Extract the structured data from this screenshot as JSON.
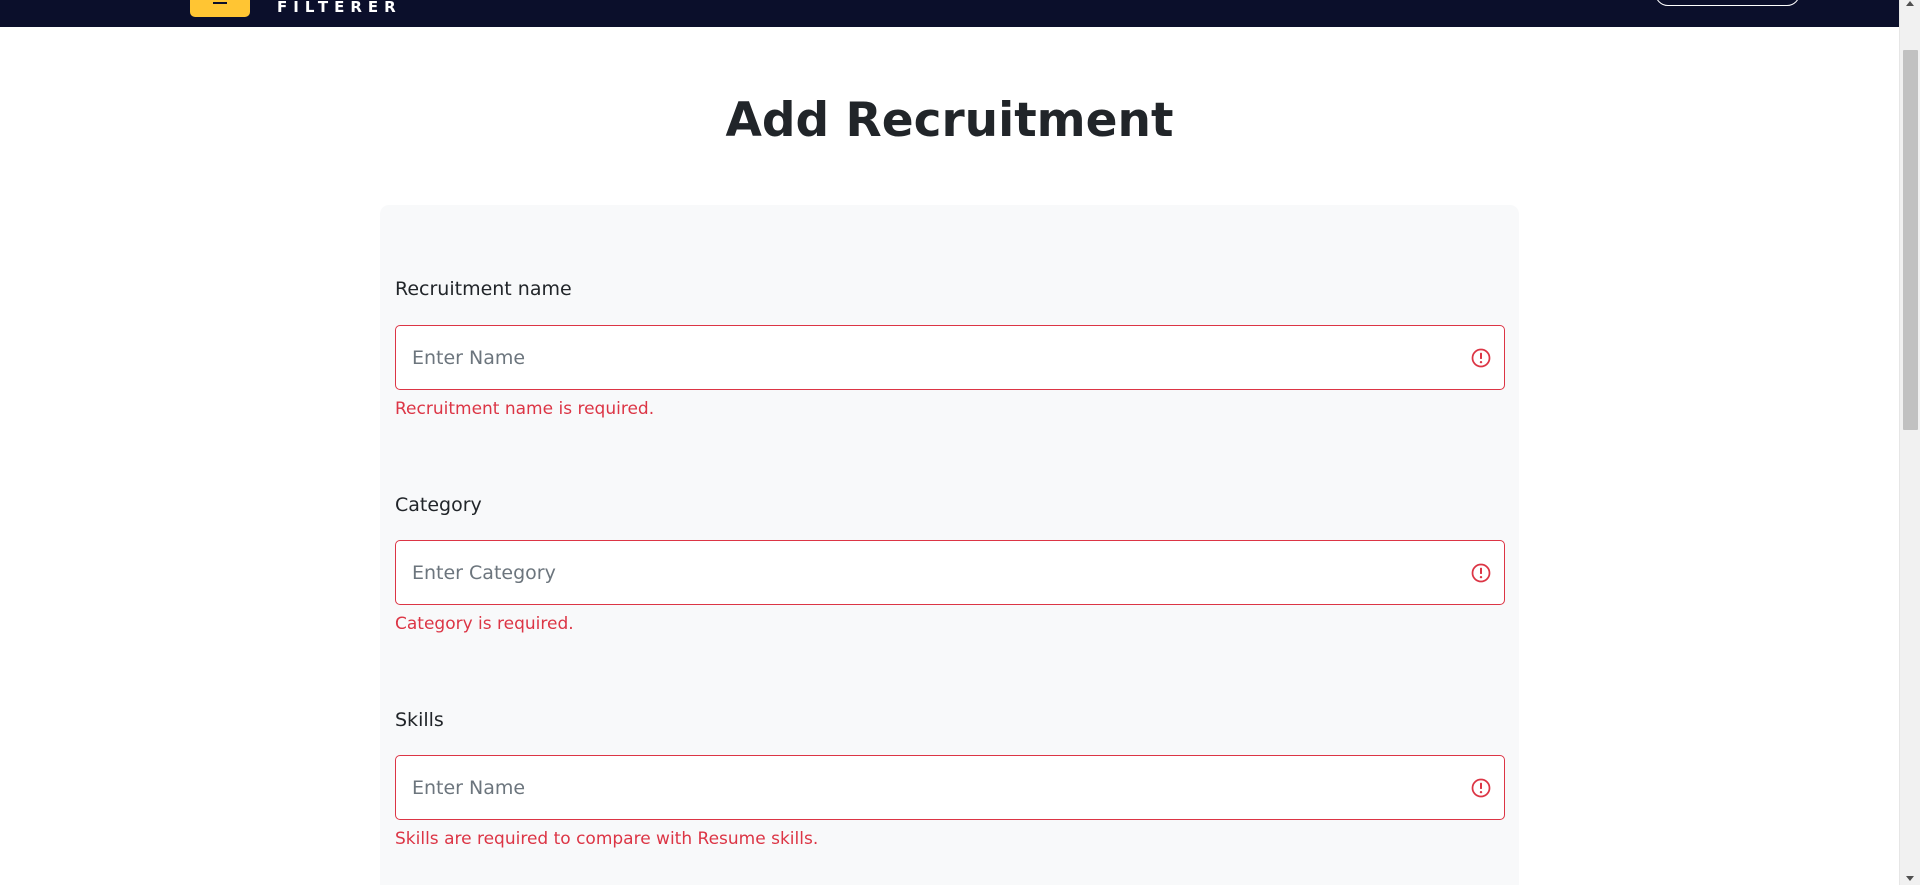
{
  "header": {
    "logo_text": "FILTERER"
  },
  "page": {
    "title": "Add Recruitment"
  },
  "form": {
    "fields": [
      {
        "label": "Recruitment name",
        "placeholder": "Enter Name",
        "value": "",
        "error": "Recruitment name is required.",
        "icon": "exclamation-circle-icon"
      },
      {
        "label": "Category",
        "placeholder": "Enter Category",
        "value": "",
        "error": "Category is required.",
        "icon": "exclamation-circle-icon"
      },
      {
        "label": "Skills",
        "placeholder": "Enter Name",
        "value": "",
        "error": "Skills are required to compare with Resume skills.",
        "icon": "exclamation-circle-icon"
      }
    ]
  },
  "colors": {
    "navbar": "#0b0f2b",
    "logo_accent": "#ffc533",
    "error": "#dc3545",
    "card_bg": "#f8f9fa"
  }
}
